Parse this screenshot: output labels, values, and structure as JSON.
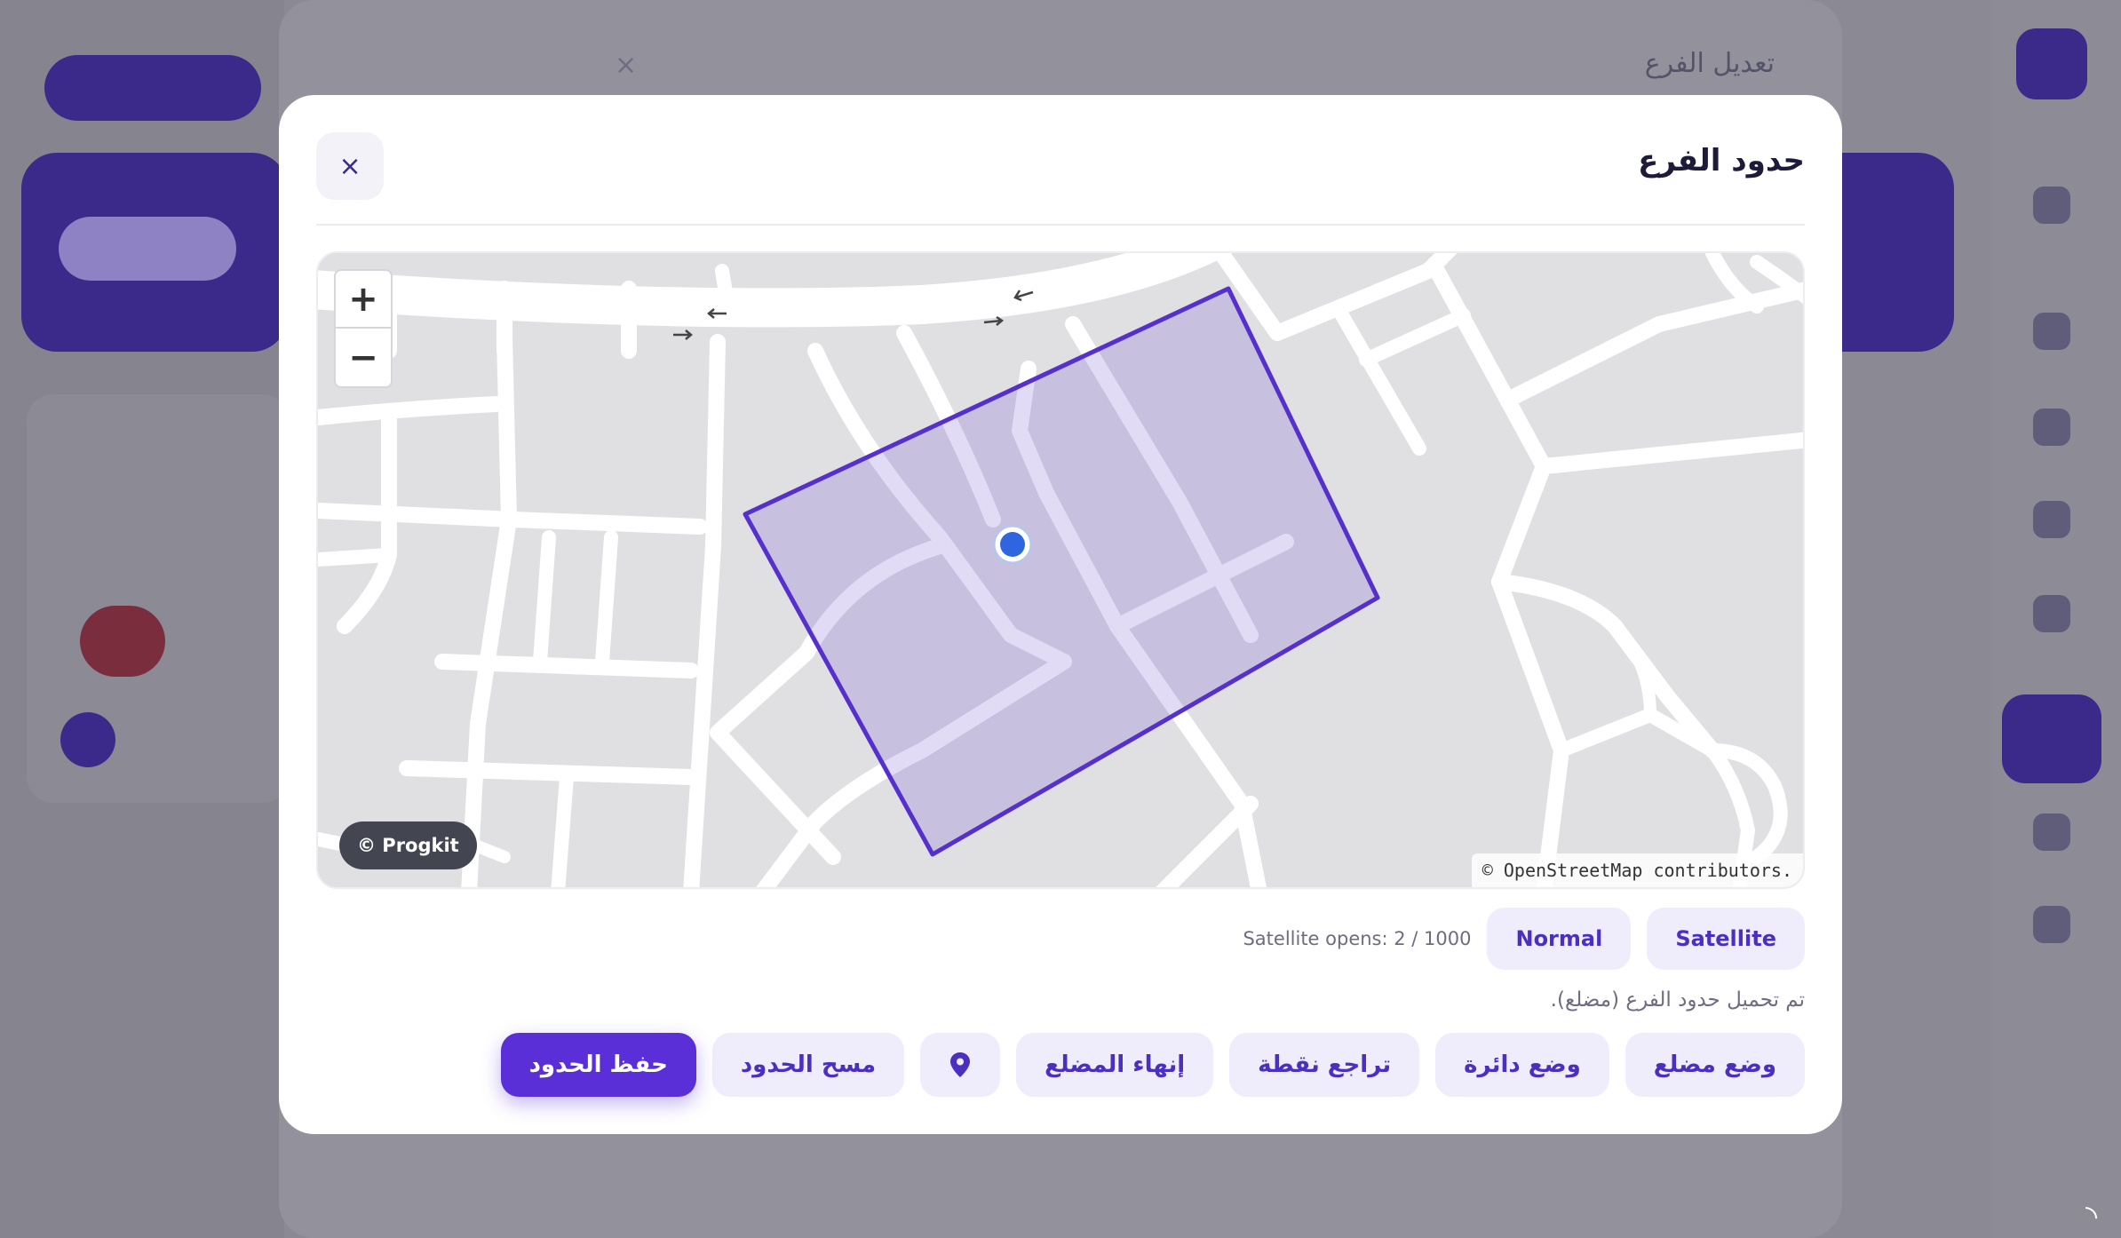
{
  "background": {
    "page_title": "تعديل الفرع",
    "close_label": "×"
  },
  "modal": {
    "title": "حدود الفرع",
    "close_label": "×"
  },
  "map": {
    "zoom_in_label": "+",
    "zoom_out_label": "−",
    "watermark": "© Progkit",
    "attribution": "© OpenStreetMap contributors.",
    "marker_icon": "location-marker-icon",
    "polygon_color": "#5b36cf"
  },
  "map_type": {
    "satellite_label": "Satellite",
    "normal_label": "Normal",
    "satellite_opens": "Satellite opens: 2 / 1000"
  },
  "status_text": "تم تحميل حدود الفرع (مضلع).",
  "actions": {
    "polygon_mode": "وضع مضلع",
    "circle_mode": "وضع دائرة",
    "undo_point": "تراجع نقطة",
    "finish_polygon": "إنهاء المضلع",
    "locate_icon": "map-pin-icon",
    "clear_bounds": "مسح الحدود",
    "save_bounds": "حفظ الحدود"
  },
  "colors": {
    "accent": "#5a2fd8",
    "accent_soft": "#efecfb",
    "overlay": "#8b8a94"
  }
}
